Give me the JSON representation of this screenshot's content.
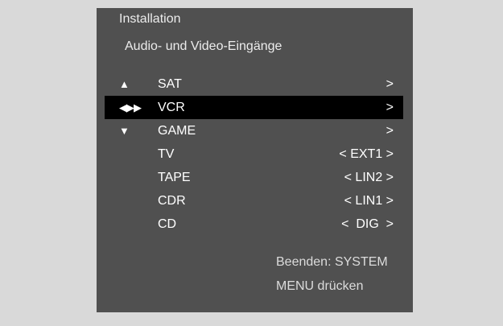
{
  "osd": {
    "title": "Installation",
    "subtitle": "Audio- und Video-Eingänge",
    "items": [
      {
        "nav_icon": "▲",
        "nav_icon_name": "up-arrow-icon",
        "label": "SAT",
        "value": ">"
      },
      {
        "nav_icon": "◀▶▶",
        "nav_icon_name": "left-right-arrow-icon",
        "label": "VCR",
        "value": ">",
        "selected": true
      },
      {
        "nav_icon": "▼",
        "nav_icon_name": "down-arrow-icon",
        "label": "GAME",
        "value": ">"
      },
      {
        "nav_icon": "",
        "label": "TV",
        "value": "< EXT1 >"
      },
      {
        "nav_icon": "",
        "label": "TAPE",
        "value": "< LIN2 >"
      },
      {
        "nav_icon": "",
        "label": "CDR",
        "value": "< LIN1 >"
      },
      {
        "nav_icon": "",
        "label": "CD",
        "value": "<  DIG  >"
      }
    ],
    "footer_line1": "Beenden: SYSTEM",
    "footer_line2": "MENU drücken",
    "colors": {
      "page_background": "#d9d9d9",
      "panel_background": "#505050",
      "selection_background": "#000000",
      "text": "#ffffff"
    }
  }
}
